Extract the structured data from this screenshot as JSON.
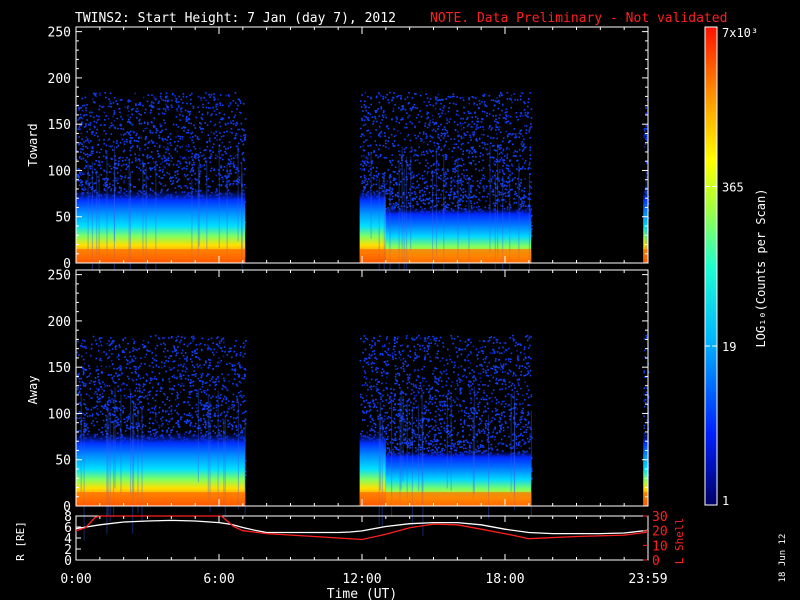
{
  "title": {
    "main": "TWINS2: Start Height:  7 Jan (day   7), 2012",
    "note": "NOTE. Data Preliminary - Not validated"
  },
  "side_date": "18 Jun 12",
  "colors": {
    "background": "#000000",
    "axes": "#ffffff",
    "note": "#ff2020",
    "lshell": "#ff2020",
    "radius": "#ffffff"
  },
  "chart_data": [
    {
      "type": "heatmap",
      "name": "Toward",
      "ylabel": "Toward",
      "ylim": [
        0,
        255
      ],
      "yticks": [
        0,
        50,
        100,
        150,
        200,
        250
      ],
      "xlim_hours": [
        0,
        24
      ],
      "data_intervals_hours": [
        [
          0.0,
          7.1
        ],
        [
          11.9,
          19.1
        ],
        [
          23.8,
          24.0
        ]
      ],
      "dense_core_upper_y": 50,
      "scatter_upper_y": 185,
      "bright_band_y": [
        0,
        15
      ]
    },
    {
      "type": "heatmap",
      "name": "Away",
      "ylabel": "Away",
      "ylim": [
        0,
        255
      ],
      "yticks": [
        0,
        50,
        100,
        150,
        200,
        250
      ],
      "xlim_hours": [
        0,
        24
      ],
      "data_intervals_hours": [
        [
          0.0,
          7.1
        ],
        [
          11.9,
          19.1
        ],
        [
          23.8,
          24.0
        ]
      ],
      "dense_core_upper_y": 50,
      "scatter_upper_y": 185,
      "bright_band_y": [
        0,
        15
      ]
    },
    {
      "type": "line",
      "name": "orbit",
      "x_tick_labels": [
        "0:00",
        "6:00",
        "12:00",
        "18:00",
        "23:59"
      ],
      "x_tick_hours": [
        0,
        6,
        12,
        18,
        24
      ],
      "xlabel": "Time (UT)",
      "y_left_label": "R [RE]",
      "y_left_ticks": [
        0,
        2,
        4,
        6,
        8
      ],
      "y_left_lim": [
        0,
        8
      ],
      "y_right_label": "L Shell",
      "y_right_ticks": [
        0,
        10,
        20,
        30
      ],
      "y_right_lim": [
        0,
        30
      ],
      "series": [
        {
          "axis": "left",
          "points": [
            [
              0,
              5.7
            ],
            [
              1,
              6.4
            ],
            [
              2,
              6.9
            ],
            [
              3,
              7.1
            ],
            [
              4,
              7.2
            ],
            [
              5,
              7.1
            ],
            [
              6,
              6.8
            ],
            [
              6.5,
              6.5
            ],
            [
              7,
              5.9
            ],
            [
              7.5,
              5.4
            ],
            [
              8,
              5.0
            ],
            [
              9,
              5.0
            ],
            [
              10,
              5.0
            ],
            [
              11,
              5.0
            ],
            [
              11.5,
              5.1
            ],
            [
              12,
              5.3
            ],
            [
              13,
              6.1
            ],
            [
              14,
              6.6
            ],
            [
              15,
              6.8
            ],
            [
              16,
              6.8
            ],
            [
              17,
              6.4
            ],
            [
              18,
              5.6
            ],
            [
              19,
              5.0
            ],
            [
              20,
              4.8
            ],
            [
              21,
              4.8
            ],
            [
              22,
              4.8
            ],
            [
              23,
              4.9
            ],
            [
              24,
              5.4
            ]
          ]
        },
        {
          "axis": "right",
          "points": [
            [
              0,
              20
            ],
            [
              0.4,
              22
            ],
            [
              0.8,
              29
            ],
            [
              1,
              32
            ],
            [
              6,
              32
            ],
            [
              6.1,
              31
            ],
            [
              6.6,
              23
            ],
            [
              7,
              20
            ],
            [
              7.5,
              19
            ],
            [
              8,
              18
            ],
            [
              10,
              16
            ],
            [
              12,
              14
            ],
            [
              13,
              17.5
            ],
            [
              14,
              22
            ],
            [
              15,
              24.5
            ],
            [
              16,
              24
            ],
            [
              17,
              21
            ],
            [
              18.3,
              17
            ],
            [
              19,
              14.5
            ],
            [
              21,
              16
            ],
            [
              23,
              17
            ],
            [
              24,
              19
            ]
          ]
        }
      ]
    },
    {
      "type": "heatmap",
      "name": "colorbar",
      "scale": "log",
      "zlim": [
        1,
        7000
      ],
      "tick_labels": [
        "7x10³",
        "365",
        "19",
        "1"
      ],
      "tick_values": [
        7000,
        365,
        19,
        1
      ],
      "label": "LOG₁₀(Counts per Scan)"
    }
  ]
}
